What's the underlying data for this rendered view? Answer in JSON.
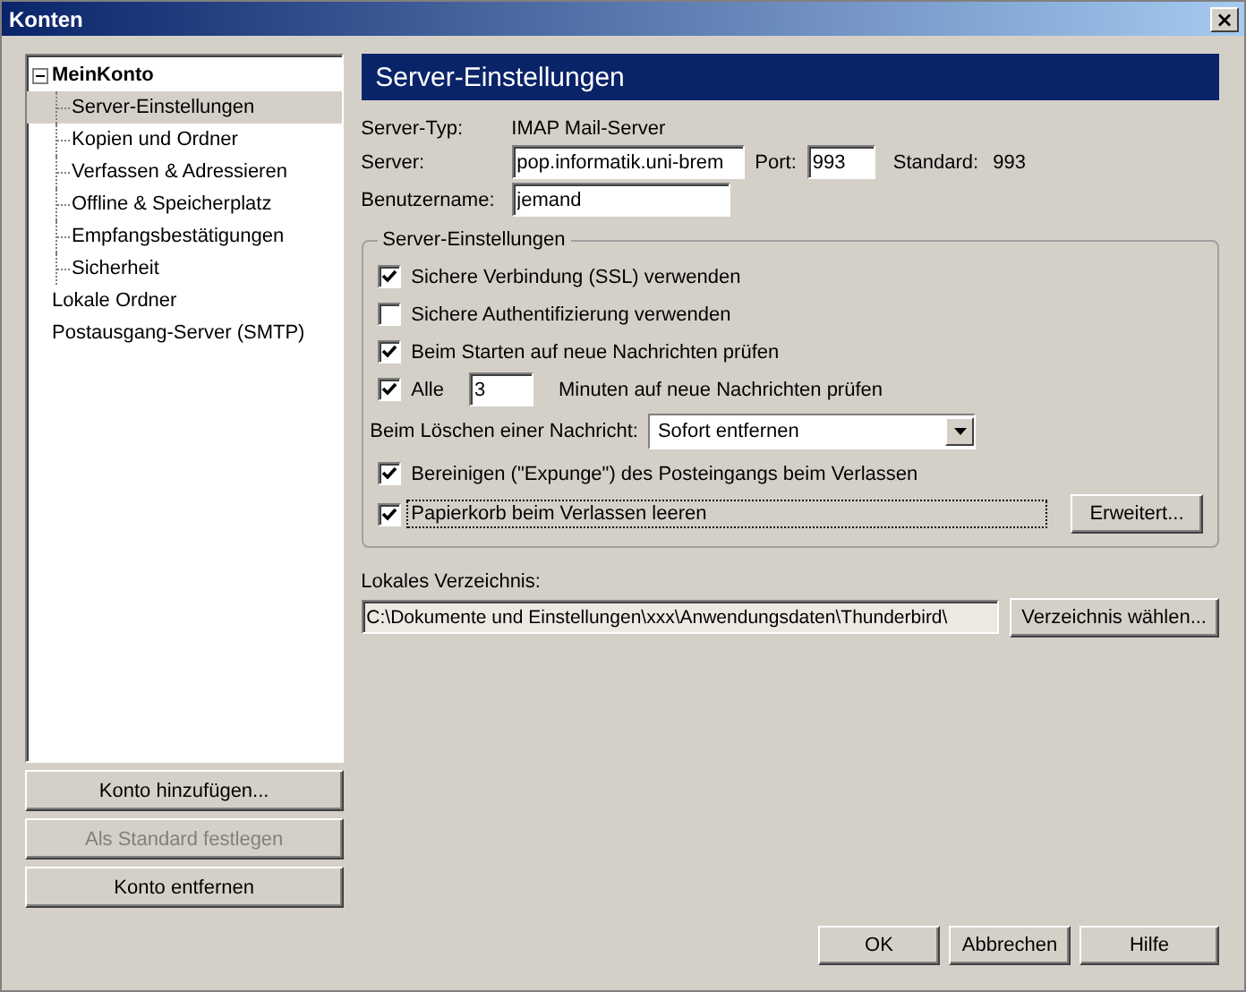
{
  "window": {
    "title": "Konten",
    "close_label": "×"
  },
  "tree": [
    {
      "label": "MeinKonto",
      "expanded": true,
      "selected": false,
      "children": [
        {
          "label": "Server-Einstellungen",
          "selected": true
        },
        {
          "label": "Kopien und Ordner",
          "selected": false
        },
        {
          "label": "Verfassen & Adressieren",
          "selected": false
        },
        {
          "label": "Offline & Speicherplatz",
          "selected": false
        },
        {
          "label": "Empfangsbestätigungen",
          "selected": false
        },
        {
          "label": "Sicherheit",
          "selected": false
        }
      ]
    },
    {
      "label": "Lokale Ordner",
      "selected": false
    },
    {
      "label": "Postausgang-Server (SMTP)",
      "selected": false
    }
  ],
  "account_buttons": [
    {
      "label": "Konto hinzufügen...",
      "disabled": false
    },
    {
      "label": "Als Standard festlegen",
      "disabled": true
    },
    {
      "label": "Konto entfernen",
      "disabled": false
    }
  ],
  "panel": {
    "title": "Server-Einstellungen",
    "server_type": {
      "label": "Server-Typ:",
      "value": "IMAP Mail-Server"
    },
    "server": {
      "label": "Server:",
      "value": "pop.informatik.uni-brem"
    },
    "port": {
      "label": "Port:",
      "value": "993"
    },
    "default_port": {
      "label": "Standard:",
      "value": "993"
    },
    "username": {
      "label": "Benutzername:",
      "value": "jemand"
    },
    "group": {
      "title": "Server-Einstellungen",
      "rows": [
        {
          "kind": "checkbox",
          "label": "Sichere Verbindung (SSL) verwenden",
          "checked": true
        },
        {
          "kind": "checkbox",
          "label": "Sichere Authentifizierung verwenden",
          "checked": false
        },
        {
          "kind": "checkbox",
          "label": "Beim Starten auf neue Nachrichten prüfen",
          "checked": true
        },
        {
          "kind": "interval",
          "label": "Alle",
          "checked": true,
          "value": "3",
          "suffix": "Minuten auf neue Nachrichten prüfen"
        },
        {
          "kind": "select",
          "label": "Beim Löschen einer Nachricht:",
          "value": "Sofort entfernen"
        },
        {
          "kind": "checkbox",
          "label": "Bereinigen (\"Expunge\") des Posteingangs beim Verlassen",
          "checked": true
        },
        {
          "kind": "checkbox_button",
          "label": "Papierkorb beim Verlassen leeren",
          "checked": true,
          "focused": true,
          "button": "Erweitert..."
        }
      ]
    },
    "local_dir": {
      "label": "Lokales Verzeichnis:",
      "value": "C:\\Dokumente und Einstellungen\\xxx\\Anwendungsdaten\\Thunderbird\\",
      "readonly": true,
      "button": "Verzeichnis wählen..."
    }
  },
  "dialog_buttons": [
    "OK",
    "Abbrechen",
    "Hilfe"
  ]
}
